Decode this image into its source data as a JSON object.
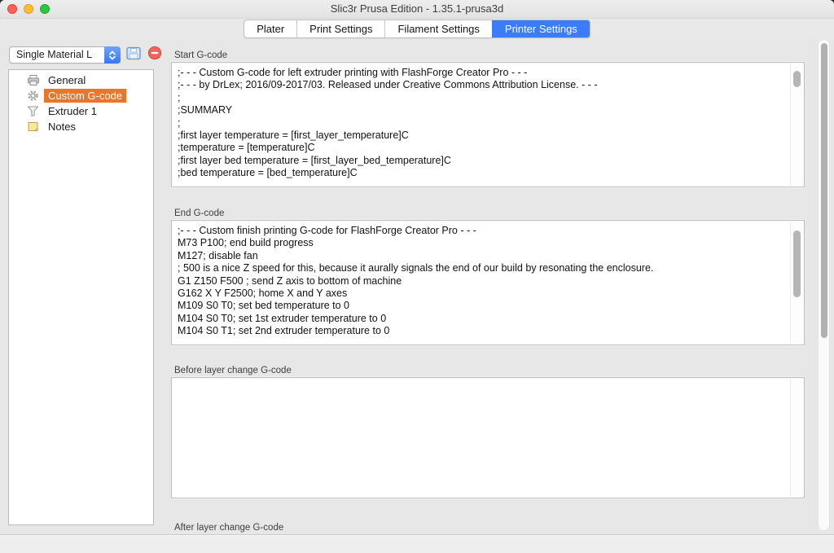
{
  "window": {
    "title": "Slic3r Prusa Edition - 1.35.1-prusa3d"
  },
  "tabs": {
    "items": [
      {
        "label": "Plater",
        "active": false
      },
      {
        "label": "Print Settings",
        "active": false
      },
      {
        "label": "Filament Settings",
        "active": false
      },
      {
        "label": "Printer Settings",
        "active": true
      }
    ]
  },
  "sidebar": {
    "preset_select": {
      "value": "Single Material L"
    },
    "buttons": [
      {
        "name": "save-preset",
        "icon": "floppy-disk-icon"
      },
      {
        "name": "delete-preset",
        "icon": "minus-circle-icon"
      }
    ],
    "tree": [
      {
        "label": "General",
        "icon": "printer-icon",
        "selected": false
      },
      {
        "label": "Custom G-code",
        "icon": "gear-icon",
        "selected": true
      },
      {
        "label": "Extruder 1",
        "icon": "funnel-icon",
        "selected": false
      },
      {
        "label": "Notes",
        "icon": "note-icon",
        "selected": false
      }
    ]
  },
  "main": {
    "sections": [
      {
        "label": "Start G-code",
        "value": ";- - - Custom G-code for left extruder printing with FlashForge Creator Pro - - -\n;- - - by DrLex; 2016/09-2017/03. Released under Creative Commons Attribution License. - - -\n;\n;SUMMARY\n;\n;first layer temperature = [first_layer_temperature]C\n;temperature = [temperature]C\n;first layer bed temperature = [first_layer_bed_temperature]C\n;bed temperature = [bed_temperature]C"
      },
      {
        "label": "End G-code",
        "value": ";- - - Custom finish printing G-code for FlashForge Creator Pro - - -\nM73 P100; end build progress\nM127; disable fan\n; 500 is a nice Z speed for this, because it aurally signals the end of our build by resonating the enclosure.\nG1 Z150 F500 ; send Z axis to bottom of machine\nG162 X Y F2500; home X and Y axes\nM109 S0 T0; set bed temperature to 0\nM104 S0 T0; set 1st extruder temperature to 0\nM104 S0 T1; set 2nd extruder temperature to 0"
      },
      {
        "label": "Before layer change G-code",
        "value": ""
      },
      {
        "label": "After layer change G-code",
        "value": ""
      }
    ]
  },
  "colors": {
    "accent_blue": "#3b7df8",
    "selection_orange": "#e8772b",
    "traffic_red": "#ff5f57",
    "traffic_yellow": "#febc2e",
    "traffic_green": "#28c840"
  }
}
